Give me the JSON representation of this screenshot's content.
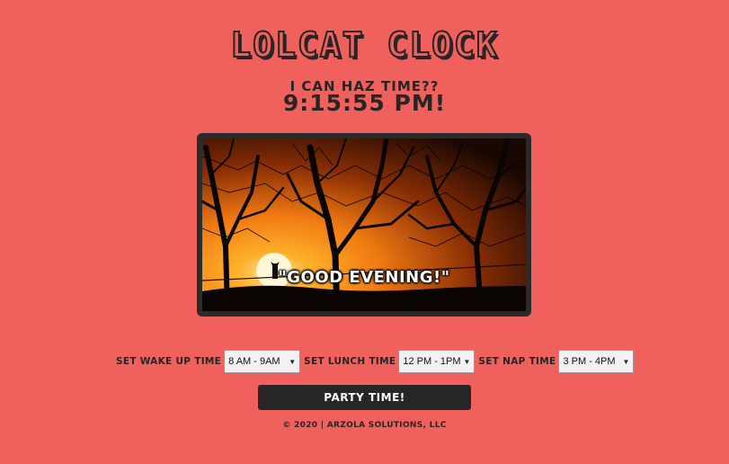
{
  "header": {
    "title": "Lolcat Clock",
    "subtitle": "I can haz time??",
    "clock": "9:15:55 PM!"
  },
  "image": {
    "caption": "\"GOOD EVENING!\"",
    "subject": "cat silhouette at sunset"
  },
  "controls": {
    "wake_label": "Set Wake Up Time",
    "wake_value": "8 AM - 9AM",
    "lunch_label": "Set Lunch Time",
    "lunch_value": "12 PM - 1PM",
    "nap_label": "Set Nap Time",
    "nap_value": "3 PM - 4PM"
  },
  "party_button": "Party Time!",
  "footer": "© 2020 | Arzola Solutions, LLC",
  "colors": {
    "background": "#f0605c",
    "dark": "#262626"
  }
}
